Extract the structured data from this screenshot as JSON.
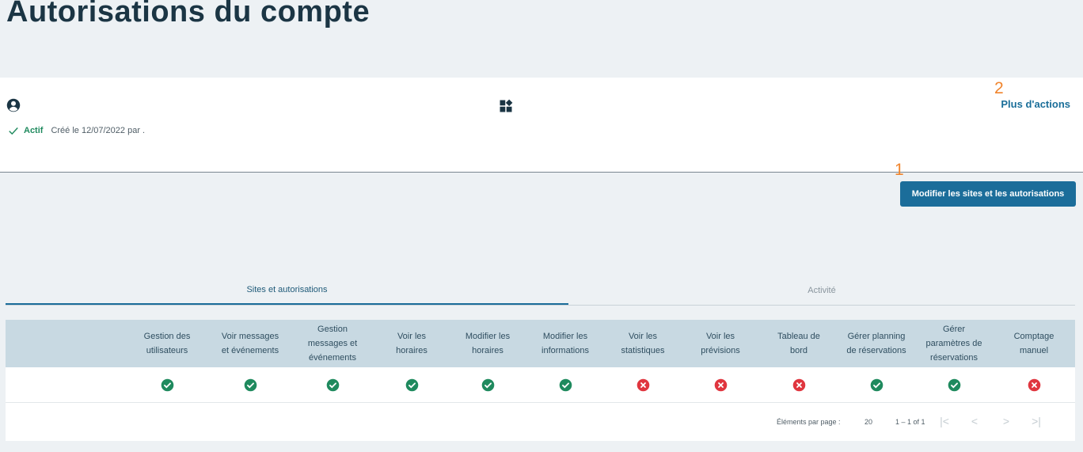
{
  "page": {
    "title": "Autorisations du compte"
  },
  "account": {
    "status": "Actif",
    "created": "Créé le 12/07/2022 par ."
  },
  "markers": [
    "1",
    "2"
  ],
  "actions": {
    "more_actions": "Plus d'actions",
    "edit_button": "Modifier les sites et les autorisations"
  },
  "tabs": [
    {
      "label": "Sites et autorisations",
      "active": true
    },
    {
      "label": "Activité",
      "active": false
    }
  ],
  "table": {
    "columns": [
      [
        "Gestion des",
        "utilisateurs"
      ],
      [
        "Voir messages",
        "et événements"
      ],
      [
        "Gestion",
        "messages et",
        "événements"
      ],
      [
        "Voir les",
        "horaires"
      ],
      [
        "Modifier les",
        "horaires"
      ],
      [
        "Modifier les",
        "informations"
      ],
      [
        "Voir les",
        "statistiques"
      ],
      [
        "Voir les",
        "prévisions"
      ],
      [
        "Tableau de",
        "bord"
      ],
      [
        "Gérer planning",
        "de réservations"
      ],
      [
        "Gérer",
        "paramètres de",
        "réservations"
      ],
      [
        "Comptage",
        "manuel"
      ]
    ],
    "rows": [
      [
        true,
        true,
        true,
        true,
        true,
        true,
        false,
        false,
        false,
        true,
        true,
        false
      ]
    ]
  },
  "pagination": {
    "items_per_page_label": "Éléments par page :",
    "items_per_page": "20",
    "range": "1 – 1 of 1"
  },
  "colors": {
    "accent": "#1b6d9a",
    "ok": "#1f8a5e",
    "ko": "#e0363f",
    "marker": "#f0842c"
  }
}
